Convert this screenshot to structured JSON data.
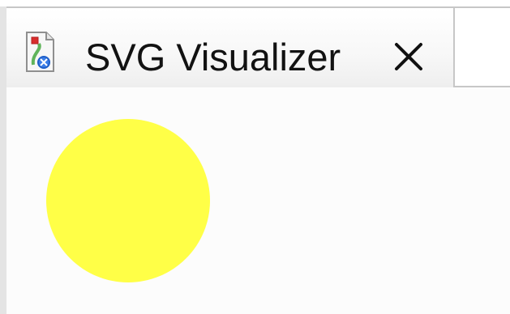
{
  "tab": {
    "title": "SVG Visualizer",
    "icon_name": "svg-file-icon",
    "close_icon_name": "close-icon"
  },
  "svg_content": {
    "shape": "circle",
    "fill_color": "#ffff47"
  },
  "colors": {
    "tab_border": "#c7c7c7",
    "editor_background": "#fcfcfc",
    "circle_fill": "#ffff47"
  }
}
